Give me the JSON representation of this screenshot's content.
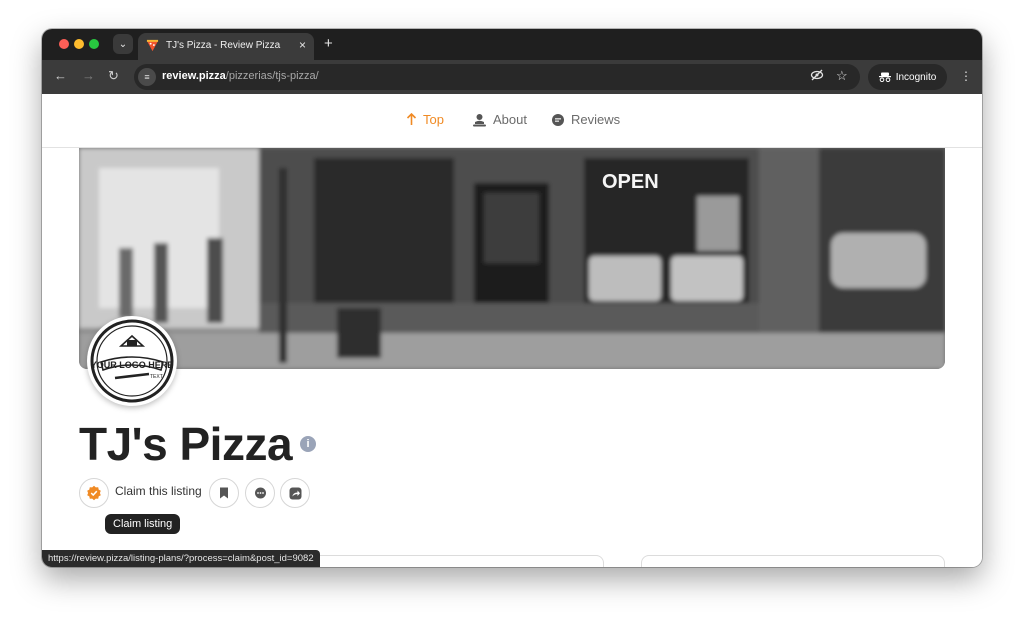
{
  "browser": {
    "tab": {
      "title": "TJ's Pizza - Review Pizza",
      "favicon": "pizza-slice-icon",
      "close_icon": "close-icon"
    },
    "new_tab_icon": "plus-icon",
    "address": {
      "host": "review.pizza",
      "path": "/pizzerias/tjs-pizza/"
    },
    "incognito_label": "Incognito",
    "status_url": "https://review.pizza/listing-plans/?process=claim&post_id=9082"
  },
  "site_nav": {
    "items": [
      {
        "label": "Top",
        "icon": "arrow-up-icon",
        "active": true
      },
      {
        "label": "About",
        "icon": "user-pin-icon",
        "active": false
      },
      {
        "label": "Reviews",
        "icon": "chat-bubble-icon",
        "active": false
      }
    ]
  },
  "cover": {
    "sign_text": "OPEN"
  },
  "logo": {
    "line1": "YOUR LOGO HERE",
    "line2": "TEXT"
  },
  "listing": {
    "title": "TJ's Pizza",
    "info_icon": "info-icon",
    "claim_label": "Claim this listing",
    "tooltip": "Claim listing"
  },
  "colors": {
    "accent": "#f08a24",
    "dark": "#222222"
  }
}
